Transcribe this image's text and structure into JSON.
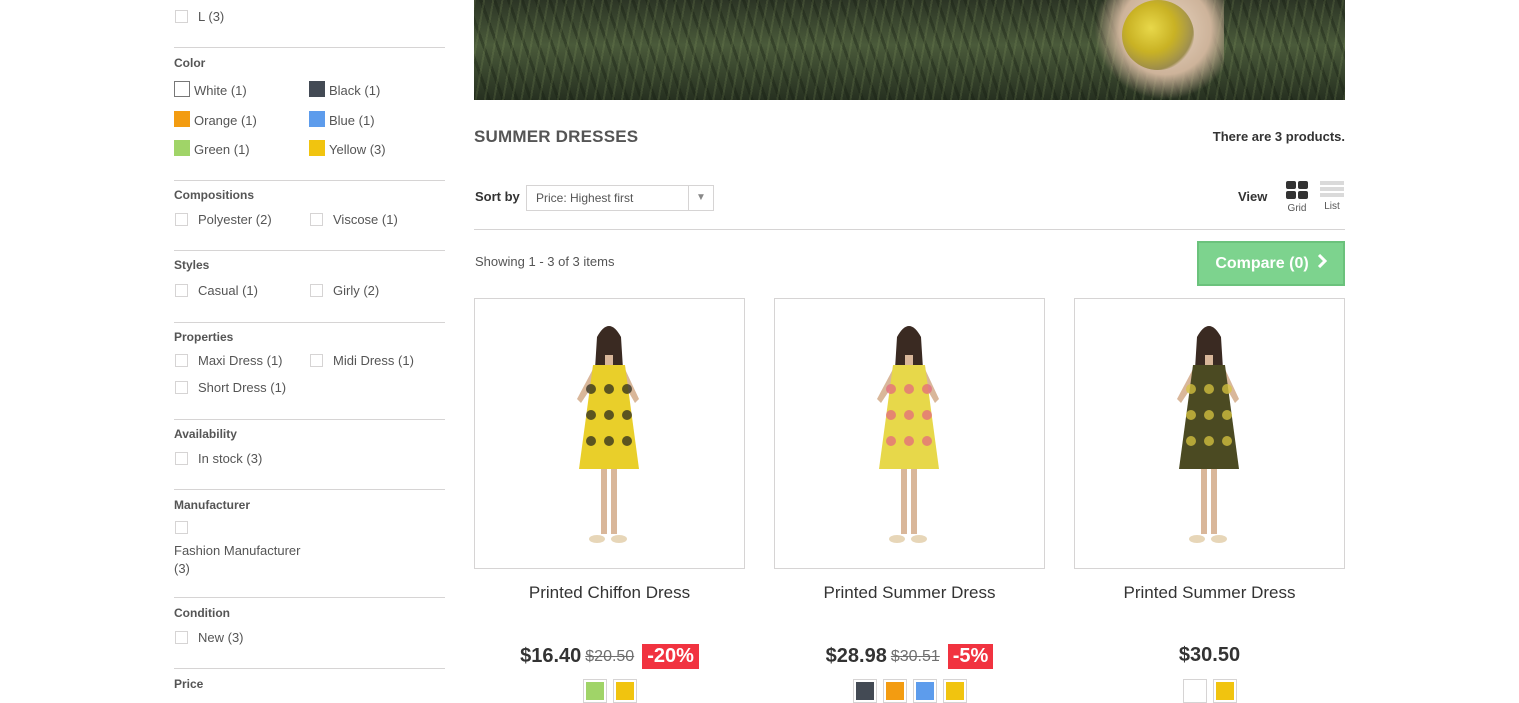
{
  "colors": {
    "white": "#ffffff",
    "black": "#434a54",
    "orange": "#f39c11",
    "blue": "#5d9cec",
    "green": "#a0d468",
    "yellow": "#f1c40f",
    "compare_bg": "#7dd38e",
    "reduction_bg": "#f13340"
  },
  "sidebar": {
    "size_options": [
      {
        "label": "L (3)"
      }
    ],
    "color": {
      "title": "Color",
      "options": [
        {
          "label": "White (1)",
          "color": "white"
        },
        {
          "label": "Black (1)",
          "color": "black"
        },
        {
          "label": "Orange (1)",
          "color": "orange"
        },
        {
          "label": "Blue (1)",
          "color": "blue"
        },
        {
          "label": "Green (1)",
          "color": "green"
        },
        {
          "label": "Yellow (3)",
          "color": "yellow"
        }
      ]
    },
    "compositions": {
      "title": "Compositions",
      "options": [
        {
          "label": "Polyester (2)"
        },
        {
          "label": "Viscose (1)"
        }
      ]
    },
    "styles": {
      "title": "Styles",
      "options": [
        {
          "label": "Casual (1)"
        },
        {
          "label": "Girly (2)"
        }
      ]
    },
    "properties": {
      "title": "Properties",
      "options": [
        {
          "label": "Maxi Dress (1)"
        },
        {
          "label": "Midi Dress (1)"
        },
        {
          "label": "Short Dress (1)"
        }
      ]
    },
    "availability": {
      "title": "Availability",
      "options": [
        {
          "label": "In stock (3)"
        }
      ]
    },
    "manufacturer": {
      "title": "Manufacturer",
      "options": [
        {
          "label_line1": "Fashion Manufacturer",
          "label_line2": "(3)"
        }
      ]
    },
    "condition": {
      "title": "Condition",
      "options": [
        {
          "label": "New (3)"
        }
      ]
    },
    "price": {
      "title": "Price"
    }
  },
  "main": {
    "category_title": "SUMMER DRESSES",
    "product_count": "There are 3 products.",
    "sort": {
      "label": "Sort by",
      "selected": "Price: Highest first"
    },
    "view": {
      "label": "View",
      "grid_label": "Grid",
      "list_label": "List",
      "active": "grid"
    },
    "showing": "Showing 1 - 3 of 3 items",
    "compare_label": "Compare (0)"
  },
  "products": [
    {
      "name": "Printed Chiffon Dress",
      "price": "$16.40",
      "old_price": "$20.50",
      "reduction": "-20%",
      "colors": [
        "green",
        "yellow"
      ],
      "dress_color": "#e9cf2a",
      "pattern_color": "#2b2b1e"
    },
    {
      "name": "Printed Summer Dress",
      "price": "$28.98",
      "old_price": "$30.51",
      "reduction": "-5%",
      "colors": [
        "black",
        "orange",
        "blue",
        "yellow"
      ],
      "dress_color": "#e7d84a",
      "pattern_color": "#e46b7d"
    },
    {
      "name": "Printed Summer Dress",
      "price": "$30.50",
      "old_price": "",
      "reduction": "",
      "colors": [
        "white",
        "yellow"
      ],
      "dress_color": "#4b4a22",
      "pattern_color": "#d8c640"
    }
  ]
}
